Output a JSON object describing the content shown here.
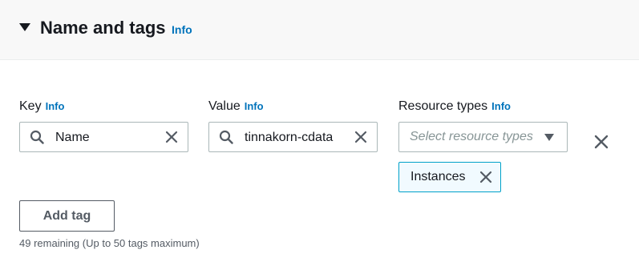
{
  "section": {
    "title": "Name and tags",
    "info_label": "Info",
    "collapse_icon": "caret-down-icon"
  },
  "key": {
    "label": "Key",
    "info_label": "Info",
    "value": "Name",
    "search_icon": "search-icon",
    "clear_icon": "close-icon"
  },
  "value_field": {
    "label": "Value",
    "info_label": "Info",
    "value": "tinnakorn-cdata",
    "search_icon": "search-icon",
    "clear_icon": "close-icon"
  },
  "resource_types": {
    "label": "Resource types",
    "info_label": "Info",
    "placeholder": "Select resource types",
    "dropdown_icon": "caret-down-icon",
    "selected": [
      "Instances"
    ]
  },
  "remove_tag_icon": "close-icon",
  "add_tag_button": "Add tag",
  "remaining_text": "49 remaining (Up to 50 tags maximum)",
  "colors": {
    "link": "#0073bb",
    "token_border": "#00a1c9",
    "token_bg": "#f1faff",
    "text": "#16191f"
  }
}
